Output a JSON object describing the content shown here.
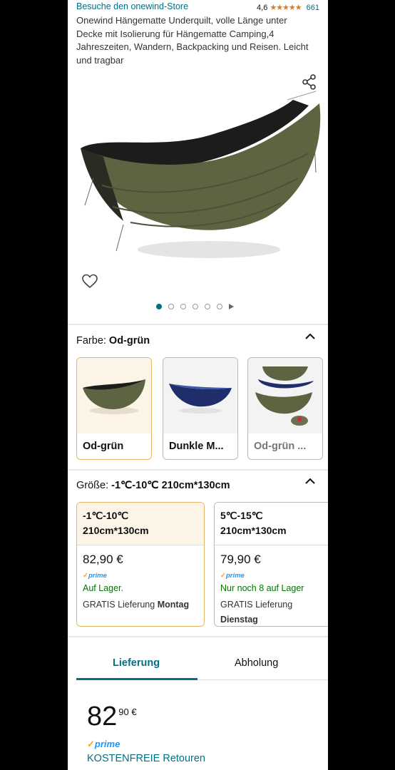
{
  "header": {
    "store_link": "Besuche den onewind-Store",
    "rating_value": "4,6",
    "stars": "★★★★★",
    "rating_count": "661"
  },
  "product": {
    "title": "Onewind Hängematte Underquilt, volle Länge unter Decke mit Isolierung für Hängematte Camping,4 Jahreszeiten, Wandern, Backpacking und Reisen. Leicht und tragbar"
  },
  "gallery": {
    "active_index": 0,
    "dot_count": 6
  },
  "color": {
    "label": "Farbe:",
    "selected": "Od-grün",
    "options": [
      {
        "label": "Od-grün"
      },
      {
        "label": "Dunkle M..."
      },
      {
        "label": "Od-grün ..."
      }
    ]
  },
  "size": {
    "label": "Größe:",
    "selected": "-1℃-10℃ 210cm*130cm",
    "options": [
      {
        "line1": "-1℃-10℃",
        "line2": "210cm*130cm",
        "price": "82,90 €",
        "prime": "prime",
        "availability": "Auf Lager.",
        "delivery_prefix": "GRATIS Lieferung",
        "delivery_day": "Montag"
      },
      {
        "line1": "5℃-15℃",
        "line2": "210cm*130cm",
        "price": "79,90 €",
        "prime": "prime",
        "availability": "Nur noch 8 auf Lager",
        "delivery_prefix": "GRATIS Lieferung",
        "delivery_day": "Dienstag"
      }
    ]
  },
  "purchase": {
    "tab_delivery": "Lieferung",
    "tab_pickup": "Abholung",
    "price_whole": "82",
    "price_fraction": "90 €",
    "prime": "prime",
    "returns": "KOSTENFREIE Retouren"
  },
  "colors": {
    "link": "#007185",
    "star": "#de7921",
    "prime_blue": "#1a98ff",
    "in_stock": "#007600",
    "selected_border": "#e8b764",
    "olive": "#5d6442",
    "navy": "#1f2e6b"
  }
}
